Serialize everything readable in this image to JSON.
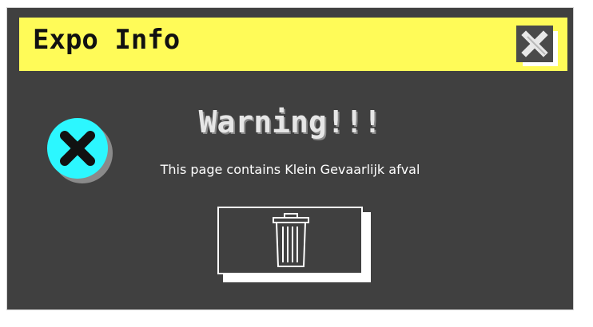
{
  "dialog": {
    "title": "Expo Info",
    "heading": "Warning!!!",
    "message": "This page contains Klein Gevaarlijk afval",
    "icons": {
      "close": "close-icon",
      "error": "error-x-icon",
      "delete": "trash-icon"
    },
    "colors": {
      "titlebar": "#fffb58",
      "window": "#404040",
      "error_icon": "#2cf7ff",
      "text": "#ffffff"
    }
  }
}
